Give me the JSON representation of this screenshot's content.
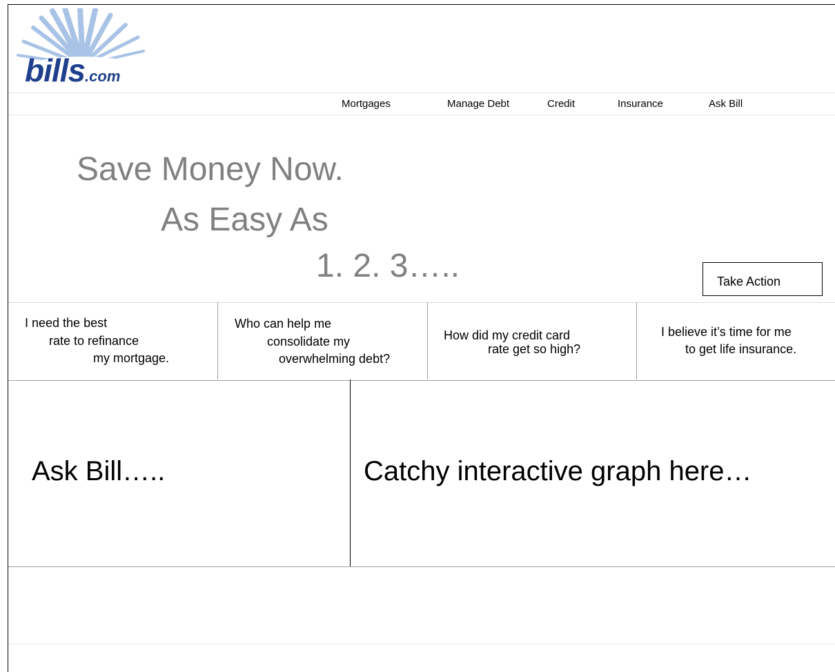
{
  "logo": {
    "name": "bills",
    "suffix": ".com",
    "color": "#1f3f8c",
    "burst_color": "#a9c3e6"
  },
  "nav": {
    "items": [
      {
        "label": "Mortgages"
      },
      {
        "label": "Manage Debt"
      },
      {
        "label": "Credit"
      },
      {
        "label": "Insurance"
      },
      {
        "label": "Ask Bill"
      }
    ]
  },
  "hero": {
    "line1": "Save Money Now.",
    "line2": "As Easy As",
    "line3": "1. 2. 3…..",
    "text_color": "#808080",
    "action_label": "Take Action"
  },
  "questions": [
    {
      "lines": [
        "I need the best",
        "rate to refinance",
        "my mortgage."
      ]
    },
    {
      "lines": [
        "Who can help me",
        "consolidate my",
        "overwhelming debt?"
      ]
    },
    {
      "lines": [
        "How did my credit card",
        "rate get so high?"
      ]
    },
    {
      "lines": [
        "I believe it’s time for me",
        "to get life insurance."
      ]
    }
  ],
  "panels": {
    "ask_bill": "Ask Bill…..",
    "graph": "Catchy interactive graph here…"
  }
}
